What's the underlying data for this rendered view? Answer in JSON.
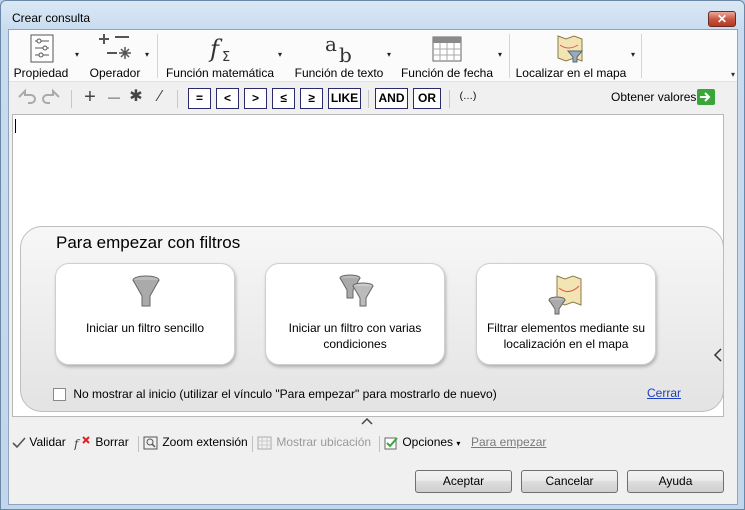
{
  "window": {
    "title": "Crear consulta",
    "close_symbol": "✕"
  },
  "ribbon": {
    "property": "Propiedad",
    "operator": "Operador",
    "math": "Función matemática",
    "text": "Función de texto",
    "date": "Función de fecha",
    "locate": "Localizar en el mapa",
    "dropdown_glyph": "▾"
  },
  "toolbar": {
    "plus": "+",
    "minus": "—",
    "multiply": "✱",
    "divide": "∕",
    "ops": [
      "=",
      "<",
      ">",
      "≤",
      "≥",
      "LIKE",
      "AND",
      "OR"
    ],
    "parens": "(…)",
    "get_values": "Obtener valores"
  },
  "starter": {
    "title": "Para empezar con filtros",
    "cards": [
      "Iniciar un filtro sencillo",
      "Iniciar un filtro con varias condiciones",
      "Filtrar elementos mediante su localización en el mapa"
    ],
    "dont_show": "No mostrar al inicio (utilizar el vínculo \"Para empezar\" para mostrarlo de nuevo)",
    "close": "Cerrar"
  },
  "statusbar": {
    "validate": "Validar",
    "clear": "Borrar",
    "zoom": "Zoom extensión",
    "show_location": "Mostrar ubicación",
    "options": "Opciones",
    "get_started": "Para empezar"
  },
  "buttons": {
    "accept": "Aceptar",
    "cancel": "Cancelar",
    "help": "Ayuda"
  },
  "colors": {
    "accent_green": "#3aa63a",
    "link_blue": "#1f3fb8",
    "op_border": "#2b2b6b"
  }
}
